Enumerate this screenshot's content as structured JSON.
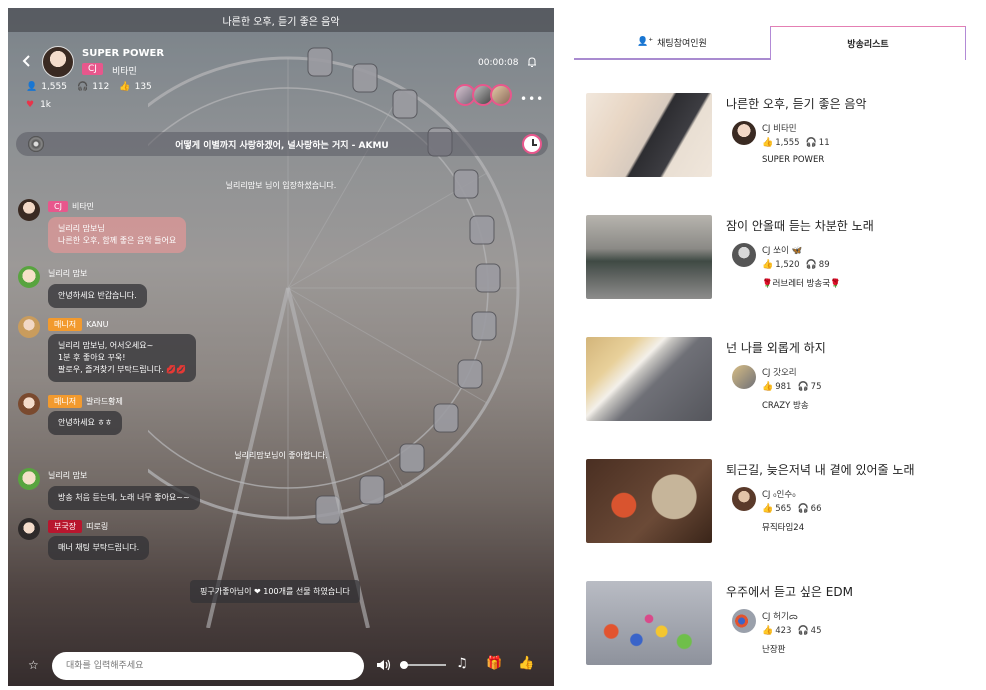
{
  "stream": {
    "title": "나른한 오후, 듣기 좋은 음악",
    "host": {
      "name": "SUPER POWER",
      "badge": "CJ",
      "sub": "비타민"
    },
    "stats": {
      "viewers": "1,555",
      "listeners": "112",
      "likes_count": "135",
      "hearts": "1k"
    },
    "timer": "00:00:08",
    "now_playing": "어떻게 이별까지 사랑하겠어, 널사랑하는 거지 - AKMU",
    "system_messages": [
      "닐리리맘보 님이 입장하셨습니다.",
      "닐리리맘보님이 좋아합니다."
    ],
    "messages": [
      {
        "badge": "CJ",
        "nick": "비타민",
        "lines": [
          "닐리리 맘보님",
          "나른한 오후, 함께 좋은 음악 들어요"
        ]
      },
      {
        "badge": "",
        "nick": "닐리리 맘보",
        "lines": [
          "안녕하세요 반갑습니다."
        ]
      },
      {
        "badge": "매니저",
        "nick": "KANU",
        "lines": [
          "닐리리 맘보님, 어서오세요~",
          "1분 후 좋아요 꾸욱!",
          "팔로우, 즐겨찾기 부탁드립니다."
        ]
      },
      {
        "badge": "매니저",
        "nick": "발라드황제",
        "lines": [
          "안녕하세요 ㅎㅎ"
        ]
      },
      {
        "badge": "",
        "nick": "닐리리 맘보",
        "lines": [
          "방송 처음 듣는데, 노래 너무 좋아요~~"
        ]
      },
      {
        "badge": "부국장",
        "nick": "띠로링",
        "lines": [
          "매너 채팅 부탁드립니다."
        ]
      }
    ],
    "gift_note": "핑구가좋아님이 ❤ 100개를 선물 하였습니다",
    "chat_placeholder": "대화를 입력해주세요"
  },
  "tabs": [
    {
      "label": "채팅참여인원"
    },
    {
      "label": "방송리스트"
    }
  ],
  "broadcasts": [
    {
      "title": "나른한 오후, 듣기 좋은 음악",
      "dj": "CJ 비타민",
      "likes": "1,555",
      "listeners": "11",
      "channel": "SUPER POWER"
    },
    {
      "title": "잠이 안올때 듣는 차분한 노래",
      "dj": "CJ 쏘이 🦋",
      "likes": "1,520",
      "listeners": "89",
      "channel": "🌹러브레터 방송국🌹"
    },
    {
      "title": "넌 나를 외롭게 하지",
      "dj": "CJ 갓오리",
      "likes": "981",
      "listeners": "75",
      "channel": "CRAZY 방송"
    },
    {
      "title": "퇴근길, 늦은저녁 내 곁에 있어줄 노래",
      "dj": "CJ ₀인수₀",
      "likes": "565",
      "listeners": "66",
      "channel": "뮤직타임24"
    },
    {
      "title": "우주에서 듣고 싶은 EDM",
      "dj": "CJ 허기ᯅ",
      "likes": "423",
      "listeners": "45",
      "channel": "난장판"
    }
  ]
}
